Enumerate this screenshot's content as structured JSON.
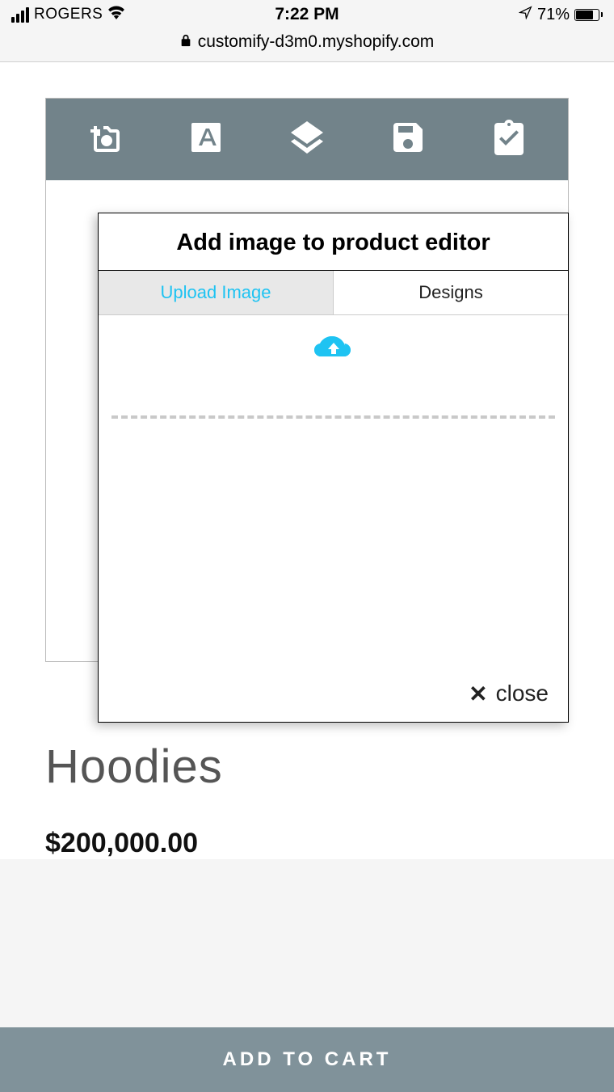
{
  "status_bar": {
    "carrier": "ROGERS",
    "time": "7:22 PM",
    "battery_percent": "71%"
  },
  "url_bar": {
    "url": "customify-d3m0.myshopify.com"
  },
  "modal": {
    "title": "Add image to product editor",
    "tabs": {
      "upload": "Upload Image",
      "designs": "Designs"
    },
    "close_label": "close"
  },
  "product": {
    "title": "Hoodies",
    "price": "$200,000.00"
  },
  "actions": {
    "add_to_cart": "ADD TO CART"
  }
}
